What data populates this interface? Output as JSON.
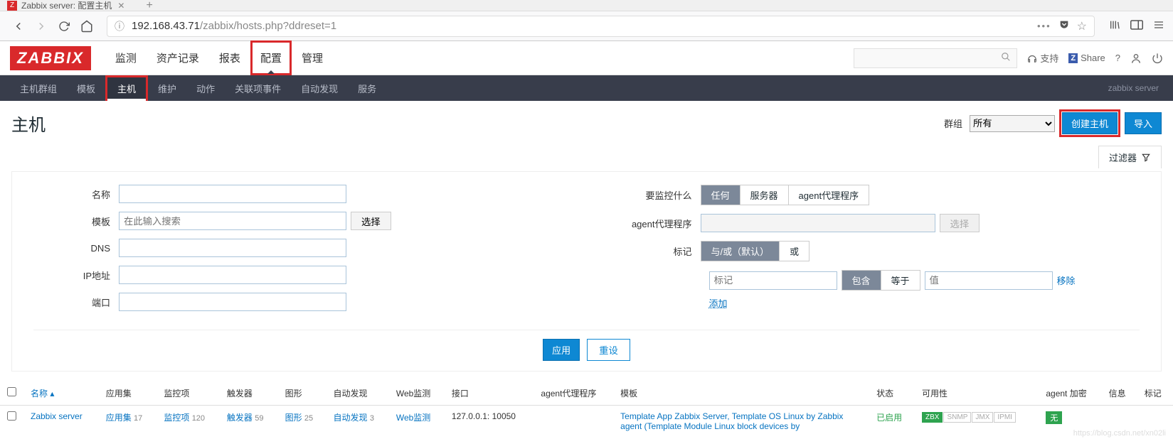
{
  "browser": {
    "tab_title": "Zabbix server: 配置主机",
    "url_host": "192.168.43.71",
    "url_path": "/zabbix/hosts.php?ddreset=1"
  },
  "header": {
    "logo": "ZABBIX",
    "nav": [
      "监测",
      "资产记录",
      "报表",
      "配置",
      "管理"
    ],
    "active_nav_index": 3,
    "support": "支持",
    "share": "Share"
  },
  "subnav": {
    "items": [
      "主机群组",
      "模板",
      "主机",
      "维护",
      "动作",
      "关联项事件",
      "自动发现",
      "服务"
    ],
    "active_index": 2,
    "server_name": "zabbix server"
  },
  "page": {
    "title": "主机",
    "group_label": "群组",
    "group_value": "所有",
    "btn_create": "创建主机",
    "btn_import": "导入",
    "filter_tab": "过滤器"
  },
  "filter": {
    "name_label": "名称",
    "template_label": "模板",
    "template_placeholder": "在此输入搜索",
    "select_btn": "选择",
    "dns_label": "DNS",
    "ip_label": "IP地址",
    "port_label": "端口",
    "monitored_by_label": "要监控什么",
    "monitored_opts": [
      "任何",
      "服务器",
      "agent代理程序"
    ],
    "proxy_label": "agent代理程序",
    "tags_label": "标记",
    "tags_mode_opts": [
      "与/或（默认）",
      "或"
    ],
    "tag_name_placeholder": "标记",
    "tag_op_opts": [
      "包含",
      "等于"
    ],
    "tag_val_placeholder": "值",
    "remove_link": "移除",
    "add_link": "添加",
    "apply_btn": "应用",
    "reset_btn": "重设"
  },
  "table": {
    "headers": {
      "name": "名称",
      "applications": "应用集",
      "items": "监控项",
      "triggers": "触发器",
      "graphs": "图形",
      "discovery": "自动发现",
      "web": "Web监测",
      "interface": "接口",
      "proxy": "agent代理程序",
      "templates": "模板",
      "status": "状态",
      "availability": "可用性",
      "agent_enc": "agent 加密",
      "info": "信息",
      "tags": "标记"
    },
    "row": {
      "name": "Zabbix server",
      "applications": {
        "label": "应用集",
        "count": "17"
      },
      "items": {
        "label": "监控项",
        "count": "120"
      },
      "triggers": {
        "label": "触发器",
        "count": "59"
      },
      "graphs": {
        "label": "图形",
        "count": "25"
      },
      "discovery": {
        "label": "自动发现",
        "count": "3"
      },
      "web": {
        "label": "Web监测"
      },
      "interface": "127.0.0.1: 10050",
      "templates": "Template App Zabbix Server, Template OS Linux by Zabbix agent (Template Module Linux block devices by",
      "status": "已启用",
      "availability": [
        "ZBX",
        "SNMP",
        "JMX",
        "IPMI"
      ],
      "encryption": "无"
    }
  },
  "watermark": "https://blog.csdn.net/xn02li"
}
